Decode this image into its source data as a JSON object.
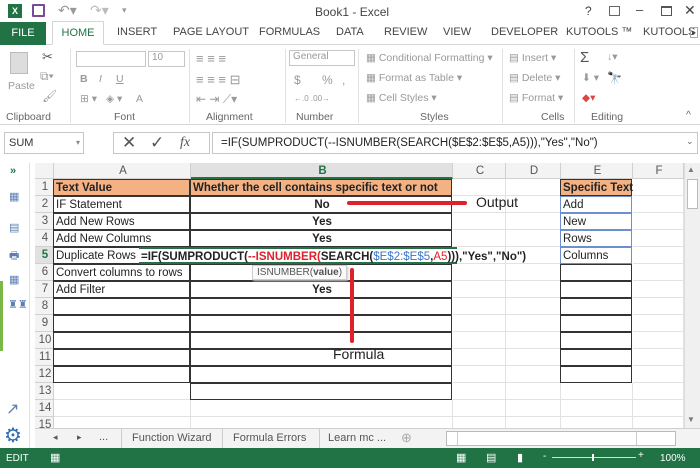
{
  "window": {
    "title": "Book1 - Excel",
    "help": "?"
  },
  "tabs": [
    "FILE",
    "HOME",
    "INSERT",
    "PAGE LAYOUT",
    "FORMULAS",
    "DATA",
    "REVIEW",
    "VIEW",
    "DEVELOPER",
    "KUTOOLS ™",
    "KUTOOLS"
  ],
  "ribbon": {
    "clipboard": {
      "label": "Clipboard",
      "paste": "Paste"
    },
    "font": {
      "label": "Font",
      "size": "10",
      "bold": "B",
      "italic": "I",
      "underline": "U",
      "font_color": "A"
    },
    "alignment": {
      "label": "Alignment"
    },
    "number": {
      "label": "Number",
      "format": "General",
      "currency": "$",
      "percent": "%",
      "comma": ","
    },
    "styles": {
      "label": "Styles",
      "conditional": "Conditional Formatting",
      "format_table": "Format as Table",
      "cell_styles": "Cell Styles"
    },
    "cells": {
      "label": "Cells",
      "insert": "Insert",
      "delete": "Delete",
      "format": "Format"
    },
    "editing": {
      "label": "Editing",
      "sum": "Σ"
    }
  },
  "formula_bar": {
    "name_box": "SUM",
    "fx": "fx",
    "formula": "=IF(SUMPRODUCT(--ISNUMBER(SEARCH($E$2:$E$5,A5))),\"Yes\",\"No\")"
  },
  "columns": [
    "A",
    "B",
    "C",
    "D",
    "E",
    "F"
  ],
  "rows": [
    "1",
    "2",
    "3",
    "4",
    "5",
    "6",
    "7",
    "8",
    "9",
    "10",
    "11",
    "12",
    "13",
    "14",
    "15"
  ],
  "cells": {
    "A1": "Text Value",
    "B1": "Whether the cell contains specific text or not",
    "E1": "Specific Text",
    "A2": "IF Statement",
    "B2": "No",
    "E2": "Add",
    "A3": "Add New Rows",
    "B3": "Yes",
    "E3": "New",
    "A4": "Add New Columns",
    "B4": "Yes",
    "E4": "Rows",
    "A5": "Duplicate Rows",
    "E5": "Columns",
    "A6": "Convert columns to rows",
    "A7": "Add Filter",
    "B7": "Yes"
  },
  "edit": {
    "p1": "=IF(SUMPRODUCT(",
    "p2": "--ISNUMBER(",
    "p3": "SEARCH(",
    "p4": "$E$2:$E$5",
    ",": ",",
    "p5": "A5",
    "p6": ")))",
    "p7": ",\"Yes\",\"No\")"
  },
  "tooltip": {
    "fn": "ISNUMBER(",
    "arg": "value",
    ")": ")"
  },
  "annotations": {
    "output": "Output",
    "formula": "Formula"
  },
  "sheet_tabs": [
    "Function Wizard",
    "Formula Errors",
    "Learn mc ..."
  ],
  "status": {
    "mode": "EDIT",
    "zoom": "100%"
  },
  "colors": {
    "excel_green": "#217346",
    "header_fill": "#f4b183",
    "red": "#e0202a"
  }
}
